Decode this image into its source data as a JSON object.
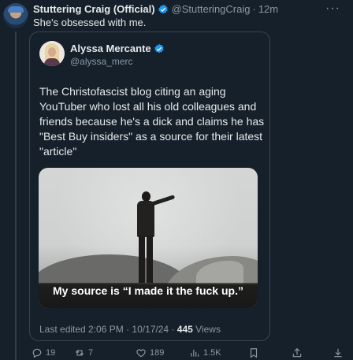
{
  "post": {
    "author_name": "Stuttering Craig (Official)",
    "handle": "@StutteringCraig",
    "separator": "·",
    "time": "12m",
    "text": "She's obsessed with me.",
    "more": "···"
  },
  "quote": {
    "author_name": "Alyssa Mercante",
    "handle": "@alyssa_merc",
    "text": "The Christofascist blog citing an aging YouTuber who lost all his old colleagues and friends because he's a dick and claims he has \"Best Buy insiders\" as a source for their latest \"article\"",
    "media_caption": "My source is “I made it the fuck up.”",
    "edited_label": "Last edited 2:06 PM · 10/17/24 · ",
    "views_count": "445",
    "views_label": " Views"
  },
  "actions": {
    "replies": "19",
    "reposts": "7",
    "likes": "189",
    "views": "1.5K"
  },
  "icons": [
    "verified-badge-icon",
    "reply-icon",
    "repost-icon",
    "like-icon",
    "views-icon",
    "bookmark-icon",
    "share-icon",
    "download-icon",
    "more-icon"
  ],
  "colors": {
    "background": "#15202b",
    "verified": "#1d9bf0",
    "muted": "#8b98a5",
    "text": "#e7e9ea"
  }
}
